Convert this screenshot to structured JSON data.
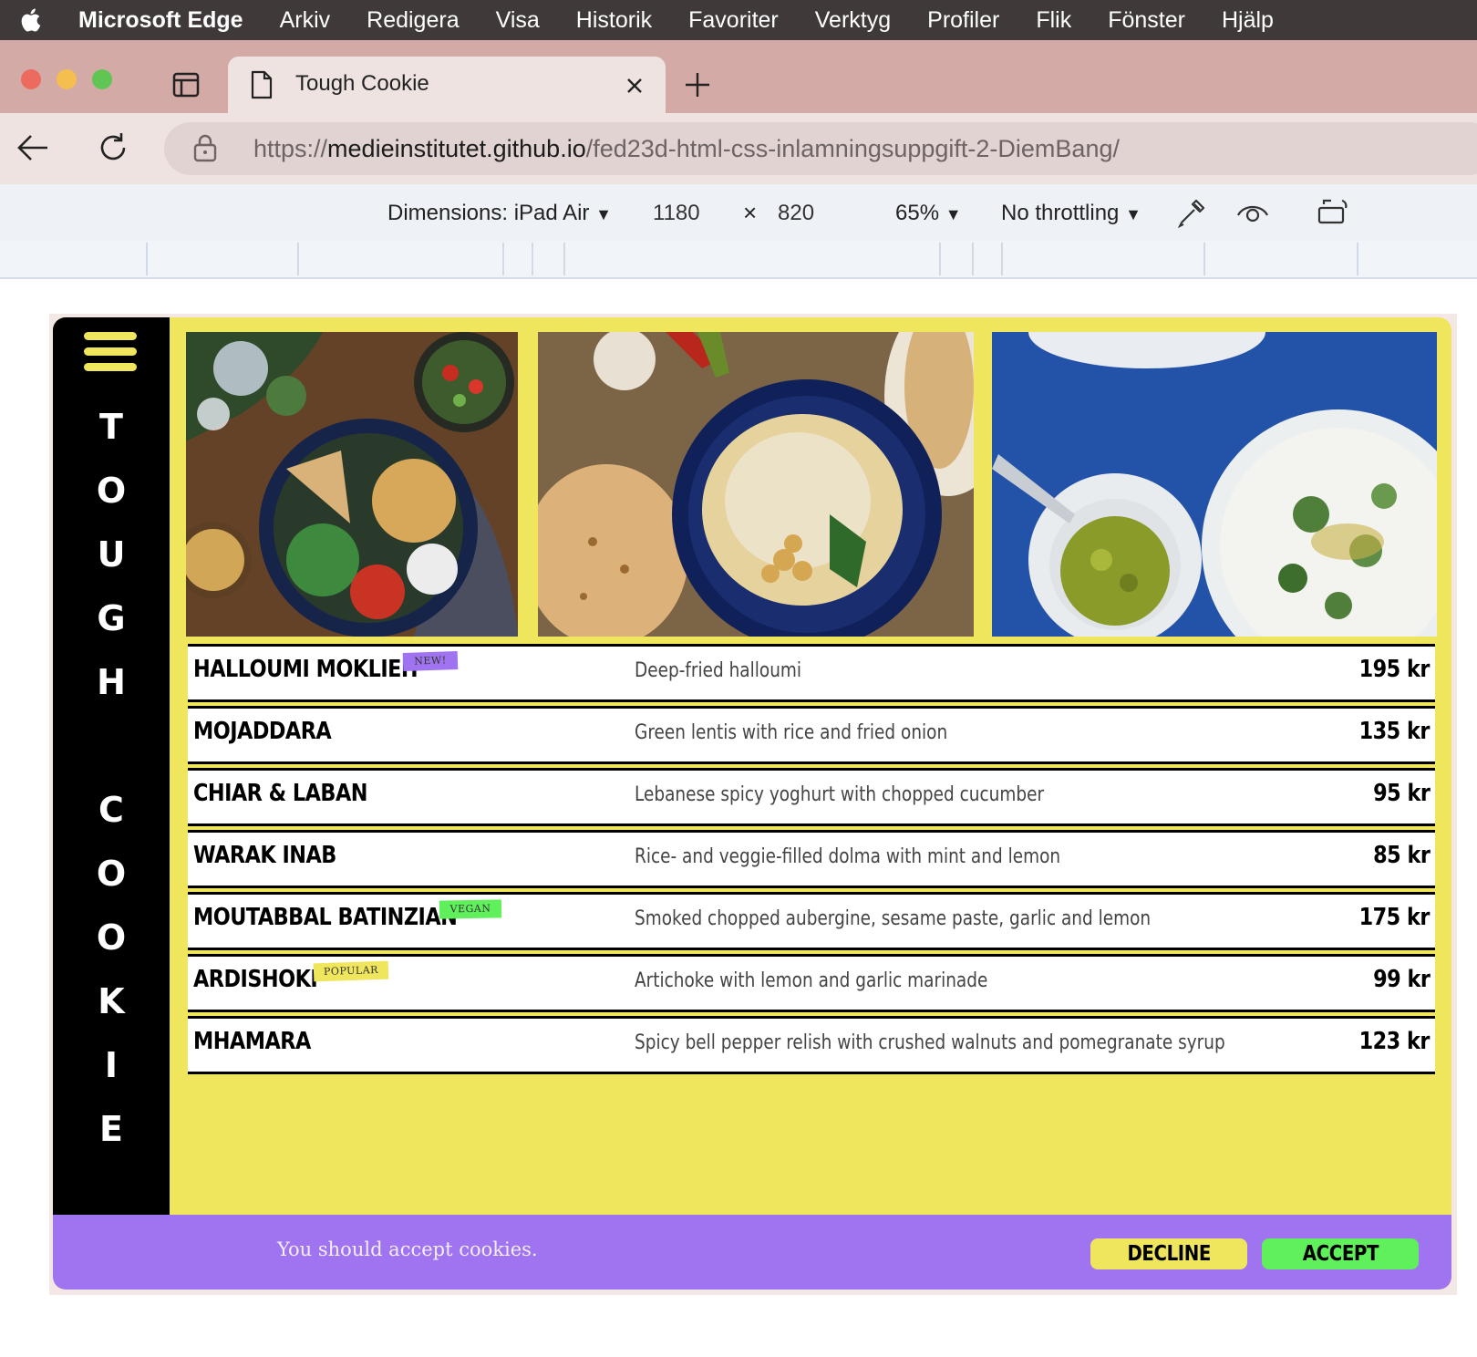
{
  "menubar": {
    "app_name": "Microsoft Edge",
    "items": [
      "Arkiv",
      "Redigera",
      "Visa",
      "Historik",
      "Favoriter",
      "Verktyg",
      "Profiler",
      "Flik",
      "Fönster",
      "Hjälp"
    ]
  },
  "tab": {
    "title": "Tough Cookie"
  },
  "address": {
    "scheme": "https://",
    "host": "medieinstitutet.github.io",
    "path": "/fed23d-html-css-inlamningsuppgift-2-DiemBang/"
  },
  "devtools": {
    "dimensions_label": "Dimensions: iPad Air",
    "width": "1180",
    "times": "×",
    "height": "820",
    "zoom": "65%",
    "throttling": "No throttling"
  },
  "site": {
    "vertical_title": [
      "T",
      "O",
      "U",
      "G",
      "H",
      "",
      "C",
      "O",
      "O",
      "K",
      "I",
      "E"
    ],
    "photos": [
      "salad-bowl-photo",
      "hummus-photo",
      "dips-photo"
    ],
    "menu": [
      {
        "name": "HALLOUMI MOKLIEH",
        "badge": "NEW!",
        "badge_color": "#a074f0",
        "desc": "Deep-fried halloumi",
        "price": "195 kr"
      },
      {
        "name": "MOJADDARA",
        "badge": "",
        "badge_color": "",
        "desc": "Green lentis with rice and fried onion",
        "price": "135 kr"
      },
      {
        "name": "CHIAR & LABAN",
        "badge": "",
        "badge_color": "",
        "desc": "Lebanese spicy yoghurt with chopped cucumber",
        "price": "95 kr"
      },
      {
        "name": "WARAK INAB",
        "badge": "",
        "badge_color": "",
        "desc": "Rice- and veggie-filled dolma with mint and lemon",
        "price": "85 kr"
      },
      {
        "name": "MOUTABBAL BATINZIAN",
        "badge": "VEGAN",
        "badge_color": "#5ff05c",
        "desc": "Smoked chopped aubergine, sesame paste, garlic and lemon",
        "price": "175 kr"
      },
      {
        "name": "ARDISHOKI",
        "badge": "POPULAR",
        "badge_color": "#efe65d",
        "desc": "Artichoke with lemon and garlic marinade",
        "price": "99 kr"
      },
      {
        "name": "MHAMARA",
        "badge": "",
        "badge_color": "",
        "desc": "Spicy bell pepper relish with crushed walnuts and pomegranate syrup",
        "price": "123 kr"
      }
    ],
    "cookie": {
      "message": "You should accept cookies.",
      "decline_label": "DECLINE",
      "accept_label": "ACCEPT"
    }
  },
  "colors": {
    "yellow": "#efe65d",
    "purple": "#a074f0",
    "green": "#5ff05c",
    "black": "#000000"
  }
}
